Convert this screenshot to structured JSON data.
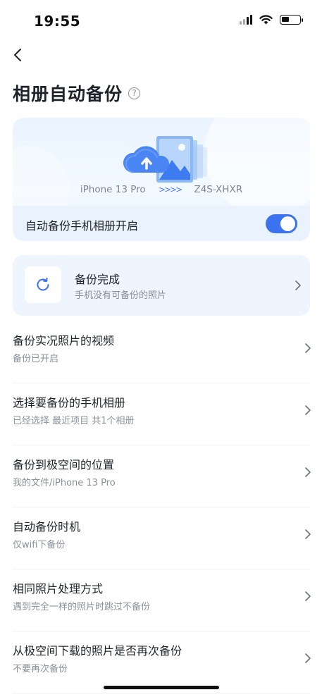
{
  "status_bar": {
    "time": "19:55"
  },
  "header": {
    "title": "相册自动备份",
    "help_glyph": "?"
  },
  "hero": {
    "device_from": "iPhone 13 Pro",
    "arrows": ">>>>",
    "device_to": "Z4S-XHXR",
    "toggle_label": "自动备份手机相册开启",
    "toggle_on": true
  },
  "backup_status": {
    "title": "备份完成",
    "subtitle": "手机没有可备份的照片"
  },
  "settings": [
    {
      "title": "备份实况照片的视频",
      "subtitle": "备份已开启"
    },
    {
      "title": "选择要备份的手机相册",
      "subtitle": "已经选择 最近项目 共1个相册"
    },
    {
      "title": "备份到极空间的位置",
      "subtitle": "我的文件/iPhone 13 Pro"
    },
    {
      "title": "自动备份时机",
      "subtitle": "仅wifi下备份"
    },
    {
      "title": "相同照片处理方式",
      "subtitle": "遇到完全一样的照片时跳过不备份"
    },
    {
      "title": "从极空间下载的照片是否再次备份",
      "subtitle": "不要再次备份"
    }
  ],
  "colors": {
    "accent": "#3a72f0",
    "card_bg": "#eef5ff",
    "muted_text": "#8a8f99"
  }
}
